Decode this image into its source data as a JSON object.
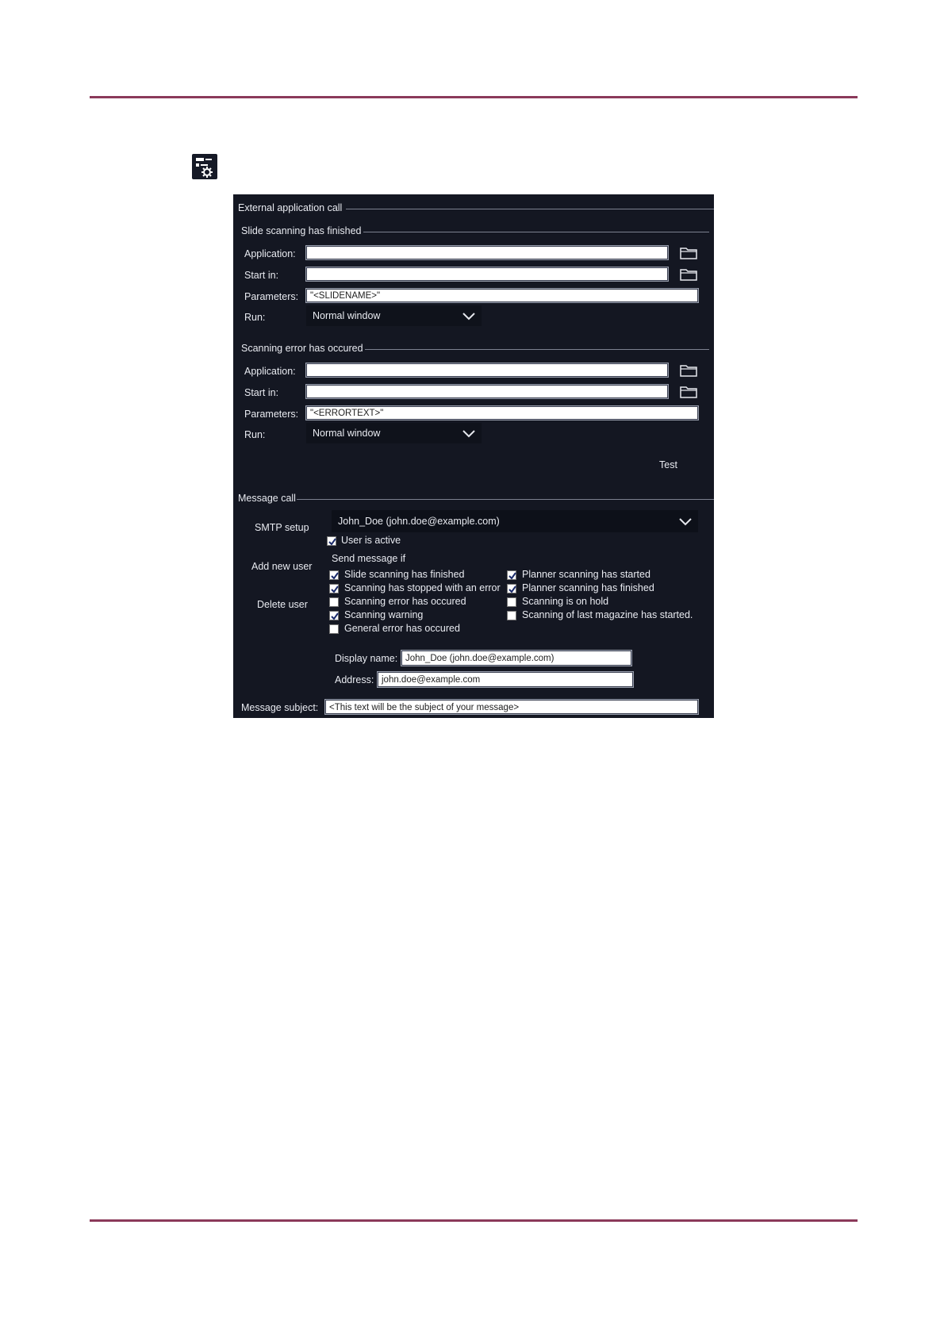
{
  "icons": {
    "settings": "settings-gear-icon",
    "folder": "folder-icon",
    "chevron": "chevron-down-icon",
    "check": "checkmark-icon"
  },
  "colors": {
    "rule": "#8b3a5a",
    "panel_bg": "#141722",
    "text": "#e9ebf1"
  },
  "external": {
    "title": "External application call",
    "finished": {
      "title": "Slide scanning has finished",
      "application_label": "Application:",
      "application_value": "",
      "startin_label": "Start in:",
      "startin_value": "",
      "parameters_label": "Parameters:",
      "parameters_value": "\"<SLIDENAME>\"",
      "run_label": "Run:",
      "run_value": "Normal window"
    },
    "error": {
      "title": "Scanning error has occured",
      "application_label": "Application:",
      "application_value": "",
      "startin_label": "Start in:",
      "startin_value": "",
      "parameters_label": "Parameters:",
      "parameters_value": "\"<ERRORTEXT>\"",
      "run_label": "Run:",
      "run_value": "Normal window"
    },
    "test_label": "Test"
  },
  "message": {
    "title": "Message call",
    "smtp_setup": "SMTP setup",
    "add_user": "Add new user",
    "delete_user": "Delete user",
    "user_select": "John_Doe (john.doe@example.com)",
    "user_active_label": "User is active",
    "user_active": true,
    "send_if_label": "Send message if",
    "conditions_left": [
      {
        "label": "Slide scanning has finished",
        "checked": true
      },
      {
        "label": "Scanning has stopped with an error",
        "checked": true
      },
      {
        "label": "Scanning error has occured",
        "checked": false
      },
      {
        "label": "Scanning warning",
        "checked": true
      },
      {
        "label": "General error has occured",
        "checked": false
      }
    ],
    "conditions_right": [
      {
        "label": "Planner scanning has started",
        "checked": true
      },
      {
        "label": "Planner scanning has finished",
        "checked": true
      },
      {
        "label": "Scanning is on hold",
        "checked": false
      },
      {
        "label": "Scanning of last magazine has started.",
        "checked": false
      }
    ],
    "display_name_label": "Display name:",
    "display_name_value": "John_Doe (john.doe@example.com)",
    "address_label": "Address:",
    "address_value": "john.doe@example.com",
    "subject_label": "Message subject:",
    "subject_value": "<This text will be the subject of your message>"
  }
}
